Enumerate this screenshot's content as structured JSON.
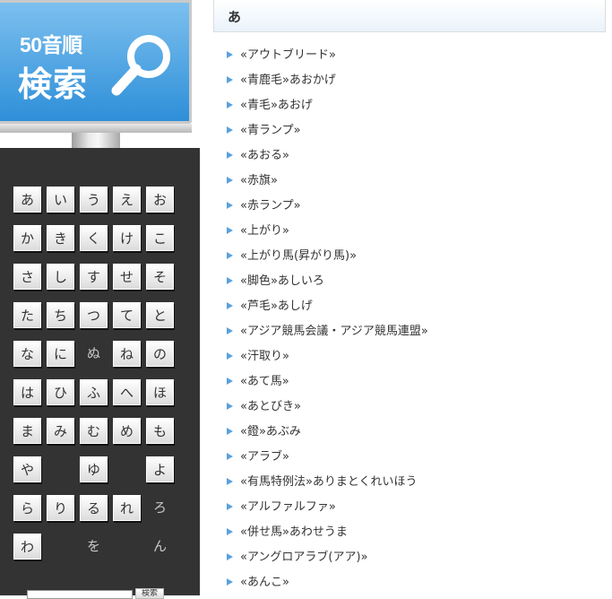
{
  "banner": {
    "line1": "50音順",
    "line2": "検索"
  },
  "kana": [
    {
      "label": "あ",
      "active": true
    },
    {
      "label": "い",
      "active": true
    },
    {
      "label": "う",
      "active": true
    },
    {
      "label": "え",
      "active": true
    },
    {
      "label": "お",
      "active": true
    },
    {
      "label": "か",
      "active": true
    },
    {
      "label": "き",
      "active": true
    },
    {
      "label": "く",
      "active": true
    },
    {
      "label": "け",
      "active": true
    },
    {
      "label": "こ",
      "active": true
    },
    {
      "label": "さ",
      "active": true
    },
    {
      "label": "し",
      "active": true
    },
    {
      "label": "す",
      "active": true
    },
    {
      "label": "せ",
      "active": true
    },
    {
      "label": "そ",
      "active": true
    },
    {
      "label": "た",
      "active": true
    },
    {
      "label": "ち",
      "active": true
    },
    {
      "label": "つ",
      "active": true
    },
    {
      "label": "て",
      "active": true
    },
    {
      "label": "と",
      "active": true
    },
    {
      "label": "な",
      "active": true
    },
    {
      "label": "に",
      "active": true
    },
    {
      "label": "ぬ",
      "active": false
    },
    {
      "label": "ね",
      "active": true
    },
    {
      "label": "の",
      "active": true
    },
    {
      "label": "は",
      "active": true
    },
    {
      "label": "ひ",
      "active": true
    },
    {
      "label": "ふ",
      "active": true
    },
    {
      "label": "へ",
      "active": true
    },
    {
      "label": "ほ",
      "active": true
    },
    {
      "label": "ま",
      "active": true
    },
    {
      "label": "み",
      "active": true
    },
    {
      "label": "む",
      "active": true
    },
    {
      "label": "め",
      "active": true
    },
    {
      "label": "も",
      "active": true
    },
    {
      "label": "や",
      "active": true
    },
    {
      "label": "",
      "active": false
    },
    {
      "label": "ゆ",
      "active": true
    },
    {
      "label": "",
      "active": false
    },
    {
      "label": "よ",
      "active": true
    },
    {
      "label": "ら",
      "active": true
    },
    {
      "label": "り",
      "active": true
    },
    {
      "label": "る",
      "active": true
    },
    {
      "label": "れ",
      "active": true
    },
    {
      "label": "ろ",
      "active": false
    },
    {
      "label": "わ",
      "active": true
    },
    {
      "label": "",
      "active": false
    },
    {
      "label": "を",
      "active": false
    },
    {
      "label": "",
      "active": false
    },
    {
      "label": "ん",
      "active": false
    }
  ],
  "search": {
    "button_label": "検索"
  },
  "header": {
    "title": "あ"
  },
  "terms": [
    "«アウトブリード»",
    "«青鹿毛»あおかげ",
    "«青毛»あおげ",
    "«青ランプ»",
    "«あおる»",
    "«赤旗»",
    "«赤ランプ»",
    "«上がり»",
    "«上がり馬(昇がり馬)»",
    "«脚色»あしいろ",
    "«芦毛»あしげ",
    "«アジア競馬会議・アジア競馬連盟»",
    "«汗取り»",
    "«あて馬»",
    "«あとびき»",
    "«鐙»あぶみ",
    "«アラブ»",
    "«有馬特例法»ありまとくれいほう",
    "«アルファルファ»",
    "«併せ馬»あわせうま",
    "«アングロアラブ(アア)»",
    "«あんこ»"
  ],
  "colors": {
    "accent": "#5aa1dd",
    "panel": "#333333",
    "screen": "#2e8fd8"
  },
  "icons": {
    "banner": "magnifier-icon",
    "list": "triangle-bullet-icon"
  }
}
